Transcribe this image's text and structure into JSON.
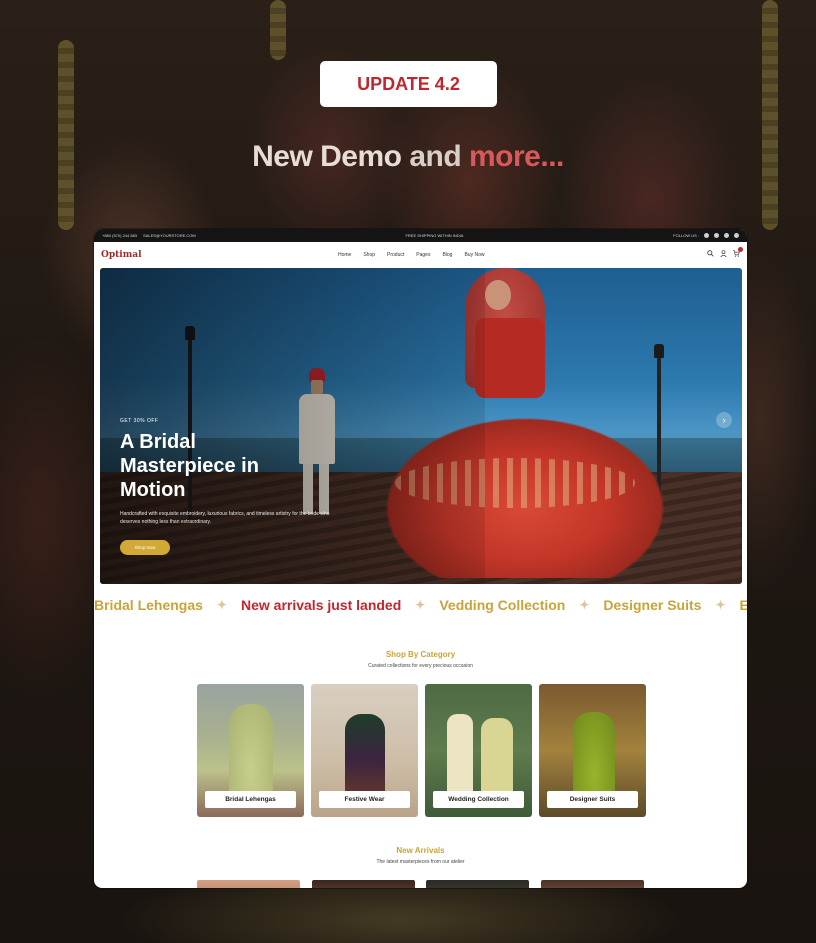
{
  "badge": {
    "label": "UPDATE 4.2"
  },
  "headline": {
    "part1": "New Demo ",
    "part2": "and",
    "part3": " more..."
  },
  "site": {
    "topbar": {
      "contact_phone": "+880 (570) 244 883",
      "contact_email": "SALES@YOURSTORE.COM",
      "promo": "FREE SHIPPING WITHIN INDIA",
      "follow_label": "FOLLOW US :"
    },
    "logo": "Optimal",
    "menu": [
      "Home",
      "Shop",
      "Product",
      "Pages",
      "Blog",
      "Buy Now"
    ],
    "hero": {
      "offer": "GET 30% OFF",
      "title": "A Bridal Masterpiece in Motion",
      "description": "Handcrafted with exquisite embroidery, luxurious fabrics, and timeless artistry for the bride who deserves nothing less than extraordinary.",
      "button": "Shop Now"
    },
    "marquee": [
      "Bridal Lehengas",
      "New arrivals just landed",
      "Vedding Collection",
      "Designer Suits",
      "Er"
    ],
    "shop_by_category": {
      "title": "Shop By Category",
      "subtitle": "Curated collections for every precious occasion",
      "items": [
        "Bridal Lehengas",
        "Festive Wear",
        "Wedding Collection",
        "Designer Suits"
      ]
    },
    "new_arrivals": {
      "title": "New Arrivals",
      "subtitle": "The latest masterpieces from our atelier"
    }
  },
  "colors": {
    "accent_gold": "#c9a43a",
    "accent_red": "#c0262d",
    "topbar": "#141414"
  },
  "icons": [
    "search-icon",
    "user-icon",
    "cart-icon",
    "facebook-icon",
    "instagram-icon",
    "youtube-icon",
    "tiktok-icon",
    "arrow-right-icon"
  ]
}
